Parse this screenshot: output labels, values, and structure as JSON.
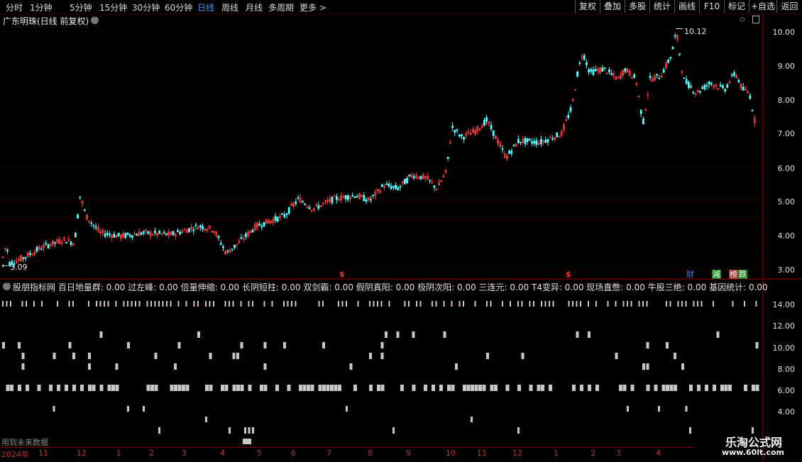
{
  "periods": [
    "分时",
    "1分钟",
    "5分钟",
    "15分钟",
    "30分钟",
    "60分钟",
    "日线",
    "周线",
    "月线",
    "多周期",
    "更多 >"
  ],
  "active_period": "日线",
  "toolbar": [
    "复权",
    "叠加",
    "多股",
    "统计",
    "画线",
    "F10",
    "标记",
    "+自选",
    "返回"
  ],
  "chart_title": "广东明珠(日线 前复权)",
  "price_axis": [
    "10.00",
    "9.00",
    "8.00",
    "7.00",
    "6.00",
    "5.00",
    "4.00",
    "3.00"
  ],
  "high_label": "10.12",
  "low_label": "3.09",
  "badges": {
    "cai": "财",
    "jian": "減",
    "bang": "榜",
    "die": "跌"
  },
  "indicator_title": "股朋指标网  百日地量群: 0.00  过左峰: 0.00  倍量伸缩: 0.00  长阴短柱: 0.00  双剑霸: 0.00  假阴真阳: 0.00  极阴次阳: 0.00  三连元: 0.00  T4变异: 0.00  现场直憋: 0.00  牛股三绝: 0.00  基因统计: 0.00",
  "indicator_axis": [
    "14.00",
    "12.00",
    "10.00",
    "8.00",
    "6.00",
    "4.00"
  ],
  "future_text": "用到未来数据",
  "year_label": "2024年",
  "months": [
    "11",
    "12",
    "1",
    "2",
    "3",
    "4",
    "5",
    "6",
    "7",
    "8",
    "9",
    "10",
    "11",
    "12",
    "1",
    "2",
    "3",
    "4"
  ],
  "watermark": {
    "name": "乐淘公式网",
    "url": "www.60lt.com"
  },
  "colors": {
    "up": "#ff3c3c",
    "down": "#54ffff",
    "grid": "#5a0000",
    "axis": "#a00000",
    "signal": "#c8c8c8",
    "active": "#3399ff"
  }
}
